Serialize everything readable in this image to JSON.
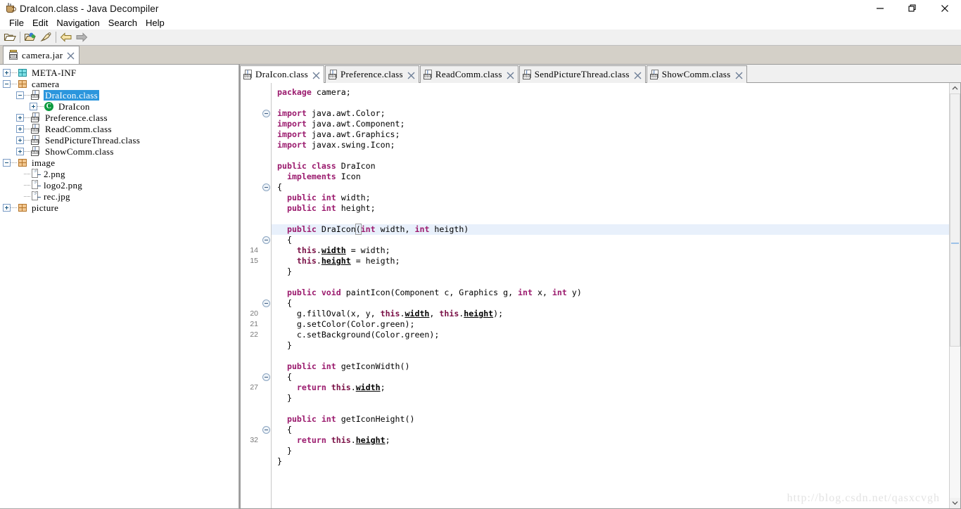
{
  "window": {
    "title": "DraIcon.class - Java Decompiler",
    "app_icon": "java-cup-icon",
    "minimize_label": "—",
    "maximize_label": "❐",
    "close_label": "✕"
  },
  "menubar": {
    "items": [
      {
        "label": "File"
      },
      {
        "label": "Edit"
      },
      {
        "label": "Navigation"
      },
      {
        "label": "Search"
      },
      {
        "label": "Help"
      }
    ]
  },
  "toolbar": {
    "buttons": [
      {
        "name": "open-file-icon",
        "title": "Open File"
      },
      {
        "name": "open-type-icon",
        "title": "Open Type"
      },
      {
        "name": "highlighter-icon",
        "title": "Highlight"
      },
      {
        "name": "back-arrow-icon",
        "title": "Back"
      },
      {
        "name": "forward-arrow-icon",
        "title": "Forward"
      }
    ]
  },
  "jar_tabs": [
    {
      "label": "camera.jar",
      "icon": "jar-icon",
      "close": "✕",
      "active": true
    }
  ],
  "tree": {
    "nodes": [
      {
        "label": "META-INF",
        "icon": "package-cyan-icon",
        "depth": 0,
        "toggle": "plus",
        "selected": false
      },
      {
        "label": "camera",
        "icon": "package-orange-icon",
        "depth": 0,
        "toggle": "minus",
        "selected": false
      },
      {
        "label": "DraIcon.class",
        "icon": "class-file-icon",
        "depth": 1,
        "toggle": "minus",
        "selected": true
      },
      {
        "label": "DraIcon",
        "icon": "class-green-c-icon",
        "depth": 2,
        "toggle": "plus",
        "selected": false
      },
      {
        "label": "Preference.class",
        "icon": "class-file-icon",
        "depth": 1,
        "toggle": "plus",
        "selected": false
      },
      {
        "label": "ReadComm.class",
        "icon": "class-file-icon",
        "depth": 1,
        "toggle": "plus",
        "selected": false
      },
      {
        "label": "SendPictureThread.class",
        "icon": "class-file-icon",
        "depth": 1,
        "toggle": "plus",
        "selected": false
      },
      {
        "label": "ShowComm.class",
        "icon": "class-file-icon",
        "depth": 1,
        "toggle": "plus",
        "selected": false
      },
      {
        "label": "image",
        "icon": "package-orange-icon",
        "depth": 0,
        "toggle": "minus",
        "selected": false
      },
      {
        "label": "2.png",
        "icon": "file-icon",
        "depth": 1,
        "toggle": "none",
        "selected": false
      },
      {
        "label": "logo2.png",
        "icon": "file-icon",
        "depth": 1,
        "toggle": "none",
        "selected": false
      },
      {
        "label": "rec.jpg",
        "icon": "file-icon",
        "depth": 1,
        "toggle": "none",
        "selected": false
      },
      {
        "label": "picture",
        "icon": "package-orange-icon",
        "depth": 0,
        "toggle": "plus",
        "selected": false
      }
    ]
  },
  "editor_tabs": [
    {
      "label": "DraIcon.class",
      "icon": "class-file-icon",
      "close": "✕",
      "active": true
    },
    {
      "label": "Preference.class",
      "icon": "class-file-icon",
      "close": "✕",
      "active": false
    },
    {
      "label": "ReadComm.class",
      "icon": "class-file-icon",
      "close": "✕",
      "active": false
    },
    {
      "label": "SendPictureThread.class",
      "icon": "class-file-icon",
      "close": "✕",
      "active": false
    },
    {
      "label": "ShowComm.class",
      "icon": "class-file-icon",
      "close": "✕",
      "active": false
    }
  ],
  "code": {
    "lines": [
      {
        "num": "",
        "fold": false,
        "highlight": false,
        "tokens": [
          {
            "t": "package ",
            "c": "kw"
          },
          {
            "t": "camera;",
            "c": ""
          }
        ]
      },
      {
        "num": "",
        "fold": false,
        "highlight": false,
        "tokens": []
      },
      {
        "num": "",
        "fold": true,
        "highlight": false,
        "tokens": [
          {
            "t": "import ",
            "c": "kw"
          },
          {
            "t": "java.awt.Color;",
            "c": ""
          }
        ]
      },
      {
        "num": "",
        "fold": false,
        "highlight": false,
        "tokens": [
          {
            "t": "import ",
            "c": "kw"
          },
          {
            "t": "java.awt.Component;",
            "c": ""
          }
        ]
      },
      {
        "num": "",
        "fold": false,
        "highlight": false,
        "tokens": [
          {
            "t": "import ",
            "c": "kw"
          },
          {
            "t": "java.awt.Graphics;",
            "c": ""
          }
        ]
      },
      {
        "num": "",
        "fold": false,
        "highlight": false,
        "tokens": [
          {
            "t": "import ",
            "c": "kw"
          },
          {
            "t": "javax.swing.Icon;",
            "c": ""
          }
        ]
      },
      {
        "num": "",
        "fold": false,
        "highlight": false,
        "tokens": []
      },
      {
        "num": "",
        "fold": false,
        "highlight": false,
        "tokens": [
          {
            "t": "public class ",
            "c": "kw"
          },
          {
            "t": "DraIcon",
            "c": ""
          }
        ]
      },
      {
        "num": "",
        "fold": false,
        "highlight": false,
        "tokens": [
          {
            "t": "  ",
            "c": ""
          },
          {
            "t": "implements ",
            "c": "kw"
          },
          {
            "t": "Icon",
            "c": ""
          }
        ]
      },
      {
        "num": "",
        "fold": true,
        "highlight": false,
        "tokens": [
          {
            "t": "{",
            "c": ""
          }
        ]
      },
      {
        "num": "",
        "fold": false,
        "highlight": false,
        "tokens": [
          {
            "t": "  ",
            "c": ""
          },
          {
            "t": "public int ",
            "c": "kw"
          },
          {
            "t": "width;",
            "c": ""
          }
        ]
      },
      {
        "num": "",
        "fold": false,
        "highlight": false,
        "tokens": [
          {
            "t": "  ",
            "c": ""
          },
          {
            "t": "public int ",
            "c": "kw"
          },
          {
            "t": "height;",
            "c": ""
          }
        ]
      },
      {
        "num": "",
        "fold": false,
        "highlight": false,
        "tokens": []
      },
      {
        "num": "",
        "fold": false,
        "highlight": true,
        "tokens": [
          {
            "t": "  ",
            "c": ""
          },
          {
            "t": "public ",
            "c": "kw"
          },
          {
            "t": "DraIcon",
            "c": ""
          },
          {
            "t": "(",
            "c": "brk"
          },
          {
            "t": "int ",
            "c": "kw"
          },
          {
            "t": "width, ",
            "c": ""
          },
          {
            "t": "int ",
            "c": "kw"
          },
          {
            "t": "heigth)",
            "c": ""
          }
        ]
      },
      {
        "num": "",
        "fold": true,
        "highlight": false,
        "tokens": [
          {
            "t": "  {",
            "c": ""
          }
        ]
      },
      {
        "num": "14",
        "fold": false,
        "highlight": false,
        "tokens": [
          {
            "t": "    ",
            "c": ""
          },
          {
            "t": "this",
            "c": "tw"
          },
          {
            "t": ".",
            "c": ""
          },
          {
            "t": "width",
            "c": "fld"
          },
          {
            "t": " = width;",
            "c": ""
          }
        ]
      },
      {
        "num": "15",
        "fold": false,
        "highlight": false,
        "tokens": [
          {
            "t": "    ",
            "c": ""
          },
          {
            "t": "this",
            "c": "tw"
          },
          {
            "t": ".",
            "c": ""
          },
          {
            "t": "height",
            "c": "fld"
          },
          {
            "t": " = heigth;",
            "c": ""
          }
        ]
      },
      {
        "num": "",
        "fold": false,
        "highlight": false,
        "tokens": [
          {
            "t": "  }",
            "c": ""
          }
        ]
      },
      {
        "num": "",
        "fold": false,
        "highlight": false,
        "tokens": []
      },
      {
        "num": "",
        "fold": false,
        "highlight": false,
        "tokens": [
          {
            "t": "  ",
            "c": ""
          },
          {
            "t": "public void ",
            "c": "kw"
          },
          {
            "t": "paintIcon(Component c, Graphics g, ",
            "c": ""
          },
          {
            "t": "int ",
            "c": "kw"
          },
          {
            "t": "x, ",
            "c": ""
          },
          {
            "t": "int ",
            "c": "kw"
          },
          {
            "t": "y)",
            "c": ""
          }
        ]
      },
      {
        "num": "",
        "fold": true,
        "highlight": false,
        "tokens": [
          {
            "t": "  {",
            "c": ""
          }
        ]
      },
      {
        "num": "20",
        "fold": false,
        "highlight": false,
        "tokens": [
          {
            "t": "    g.fillOval(x, y, ",
            "c": ""
          },
          {
            "t": "this",
            "c": "tw"
          },
          {
            "t": ".",
            "c": ""
          },
          {
            "t": "width",
            "c": "fld"
          },
          {
            "t": ", ",
            "c": ""
          },
          {
            "t": "this",
            "c": "tw"
          },
          {
            "t": ".",
            "c": ""
          },
          {
            "t": "height",
            "c": "fld"
          },
          {
            "t": ");",
            "c": ""
          }
        ]
      },
      {
        "num": "21",
        "fold": false,
        "highlight": false,
        "tokens": [
          {
            "t": "    g.setColor(Color.green);",
            "c": ""
          }
        ]
      },
      {
        "num": "22",
        "fold": false,
        "highlight": false,
        "tokens": [
          {
            "t": "    c.setBackground(Color.green);",
            "c": ""
          }
        ]
      },
      {
        "num": "",
        "fold": false,
        "highlight": false,
        "tokens": [
          {
            "t": "  }",
            "c": ""
          }
        ]
      },
      {
        "num": "",
        "fold": false,
        "highlight": false,
        "tokens": []
      },
      {
        "num": "",
        "fold": false,
        "highlight": false,
        "tokens": [
          {
            "t": "  ",
            "c": ""
          },
          {
            "t": "public int ",
            "c": "kw"
          },
          {
            "t": "getIconWidth()",
            "c": ""
          }
        ]
      },
      {
        "num": "",
        "fold": true,
        "highlight": false,
        "tokens": [
          {
            "t": "  {",
            "c": ""
          }
        ]
      },
      {
        "num": "27",
        "fold": false,
        "highlight": false,
        "tokens": [
          {
            "t": "    ",
            "c": ""
          },
          {
            "t": "return ",
            "c": "kw"
          },
          {
            "t": "this",
            "c": "tw"
          },
          {
            "t": ".",
            "c": ""
          },
          {
            "t": "width",
            "c": "fld"
          },
          {
            "t": ";",
            "c": ""
          }
        ]
      },
      {
        "num": "",
        "fold": false,
        "highlight": false,
        "tokens": [
          {
            "t": "  }",
            "c": ""
          }
        ]
      },
      {
        "num": "",
        "fold": false,
        "highlight": false,
        "tokens": []
      },
      {
        "num": "",
        "fold": false,
        "highlight": false,
        "tokens": [
          {
            "t": "  ",
            "c": ""
          },
          {
            "t": "public int ",
            "c": "kw"
          },
          {
            "t": "getIconHeight()",
            "c": ""
          }
        ]
      },
      {
        "num": "",
        "fold": true,
        "highlight": false,
        "tokens": [
          {
            "t": "  {",
            "c": ""
          }
        ]
      },
      {
        "num": "32",
        "fold": false,
        "highlight": false,
        "tokens": [
          {
            "t": "    ",
            "c": ""
          },
          {
            "t": "return ",
            "c": "kw"
          },
          {
            "t": "this",
            "c": "tw"
          },
          {
            "t": ".",
            "c": ""
          },
          {
            "t": "height",
            "c": "fld"
          },
          {
            "t": ";",
            "c": ""
          }
        ]
      },
      {
        "num": "",
        "fold": false,
        "highlight": false,
        "tokens": [
          {
            "t": "  }",
            "c": ""
          }
        ]
      },
      {
        "num": "",
        "fold": false,
        "highlight": false,
        "tokens": [
          {
            "t": "}",
            "c": ""
          }
        ]
      }
    ]
  },
  "scrollbar": {
    "up_arrow": "▲",
    "down_arrow": "▼"
  },
  "watermark": "http://blog.csdn.net/qasxcvgh",
  "colors": {
    "keyword": "#9b1b6e",
    "selection": "#2b96dd",
    "highlight_line": "#e8f0fb",
    "tab_strip": "#d4d0c8"
  }
}
